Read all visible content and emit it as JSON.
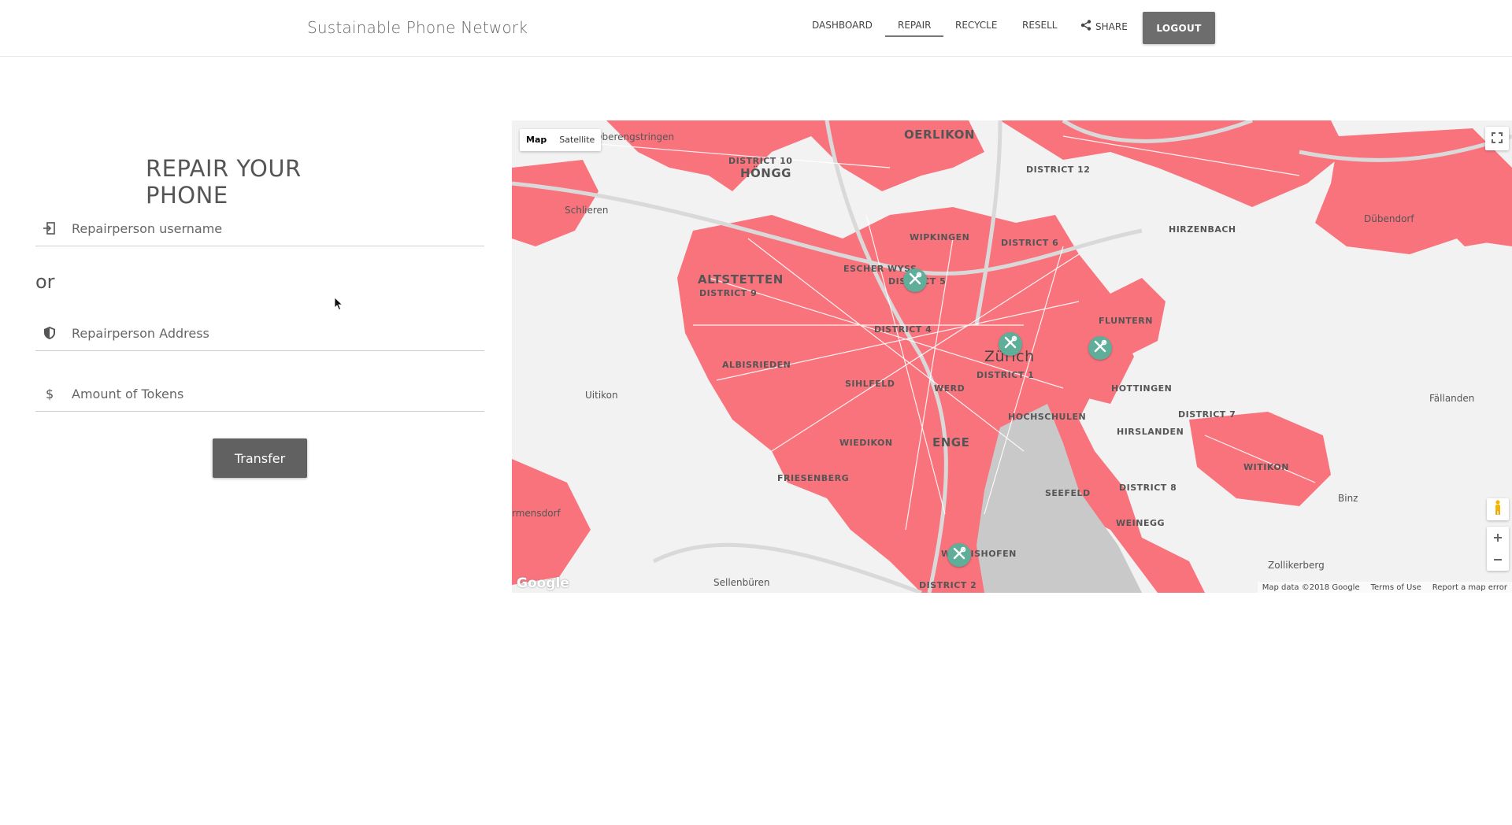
{
  "header": {
    "brand": "Sustainable Phone Network",
    "nav": {
      "dashboard": "DASHBOARD",
      "repair": "REPAIR",
      "recycle": "RECYCLE",
      "resell": "RESELL",
      "share": "SHARE"
    },
    "logout": "LOGOUT"
  },
  "form": {
    "title": "REPAIR YOUR PHONE",
    "username_placeholder": "Repairperson username",
    "or_text": "or",
    "address_placeholder": "Repairperson Address",
    "tokens_placeholder": "Amount of Tokens",
    "transfer_label": "Transfer",
    "icons": [
      "login-icon",
      "shield-icon",
      "dollar-icon"
    ]
  },
  "map": {
    "type_map": "Map",
    "type_satellite": "Satellite",
    "labels": {
      "oerlikon": "OERLIKON",
      "district10": "DISTRICT 10",
      "hongg": "HÖNGG",
      "district12": "DISTRICT 12",
      "oberengstringen": "Oberengstringen",
      "schlieren": "Schlieren",
      "wipkingen": "WIPKINGEN",
      "district6": "DISTRICT 6",
      "hirzenbach": "HIRZENBACH",
      "dubendorf": "Dübendorf",
      "escherwyss": "ESCHER WYSS",
      "district5": "DISTRICT 5",
      "altstetten": "ALTSTETTEN",
      "district9": "DISTRICT 9",
      "fluntern": "FLUNTERN",
      "district4": "DISTRICT 4",
      "zurich": "Zürich",
      "district1": "DISTRICT 1",
      "albisrieden": "ALBISRIEDEN",
      "sihlfeld": "SIHLFELD",
      "werd": "WERD",
      "hottingen": "HOTTINGEN",
      "uitikon": "Uitikon",
      "hochschulen": "HOCHSCHULEN",
      "district7": "DISTRICT 7",
      "fallanden": "Fällanden",
      "hirslanden": "HIRSLANDEN",
      "wiedikon": "WIEDIKON",
      "enge": "ENGE",
      "witikon": "WITIKON",
      "friesenberg": "FRIESENBERG",
      "seefeld": "SEEFELD",
      "district8": "DISTRICT 8",
      "binz": "Binz",
      "rmensdorf": "rmensdorf",
      "weinegg": "WEINEGG",
      "wollishofen": "WOLLISHOFEN",
      "zollikerberg": "Zollikerberg",
      "sellenburen": "Sellenbüren",
      "district2": "DISTRICT 2"
    },
    "footer": {
      "data": "Map data ©2018 Google",
      "terms": "Terms of Use",
      "report": "Report a map error"
    },
    "logo": "Google",
    "markers": [
      "repair-shop-marker",
      "repair-shop-marker",
      "repair-shop-marker",
      "repair-shop-marker"
    ],
    "colors": {
      "urban": "#f9737d",
      "background": "#f2f2f2",
      "lake": "#c9c9c9",
      "marker": "#5fae9a"
    }
  }
}
